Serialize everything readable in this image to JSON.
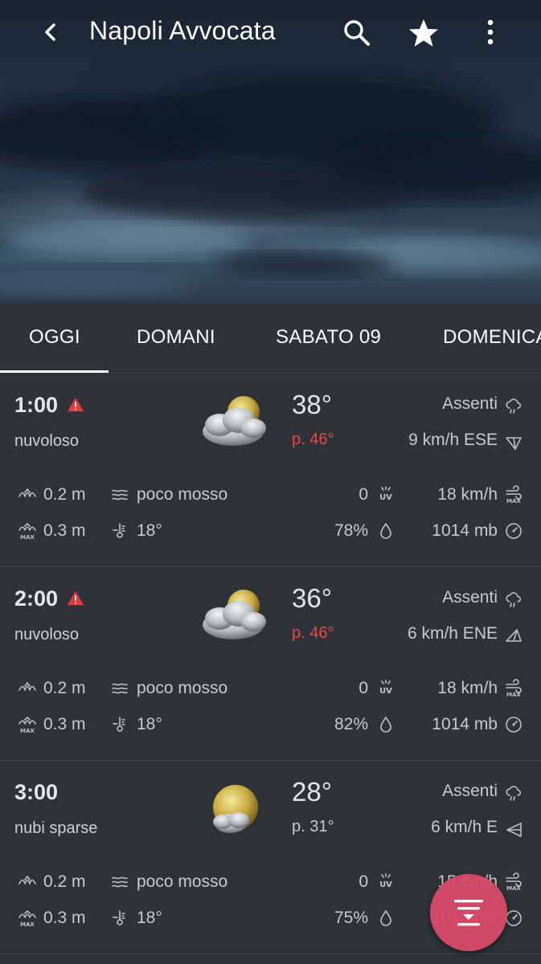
{
  "header": {
    "title": "Napoli Avvocata"
  },
  "tabs": [
    {
      "label": "OGGI",
      "selected": true
    },
    {
      "label": "DOMANI",
      "selected": false
    },
    {
      "label": "SABATO 09",
      "selected": false
    },
    {
      "label": "DOMENICA",
      "selected": false
    }
  ],
  "colors": {
    "alert": "#e5393b",
    "perceived_alert": "#e5484d",
    "perceived_normal": "#c9cacc",
    "fab": "#d64a6a"
  },
  "hours": [
    {
      "time": "1:00",
      "alert": true,
      "condition": "nuvoloso",
      "icon": "cloudy-sun-icon",
      "temp": "38°",
      "perceived": "p. 46°",
      "perceived_alert": true,
      "precipitation": "Assenti",
      "wind": "9 km/h ESE",
      "wind_dir_icon": "wind-direction-ese-icon",
      "wave_height": "0.2 m",
      "sea_state": "poco mosso",
      "uv": "0",
      "gust": "18 km/h",
      "wave_max": "0.3 m",
      "water_temp": "18°",
      "humidity": "78%",
      "pressure": "1014 mb"
    },
    {
      "time": "2:00",
      "alert": true,
      "condition": "nuvoloso",
      "icon": "cloudy-sun-icon",
      "temp": "36°",
      "perceived": "p. 46°",
      "perceived_alert": true,
      "precipitation": "Assenti",
      "wind": "6 km/h ENE",
      "wind_dir_icon": "wind-direction-ene-icon",
      "wave_height": "0.2 m",
      "sea_state": "poco mosso",
      "uv": "0",
      "gust": "18 km/h",
      "wave_max": "0.3 m",
      "water_temp": "18°",
      "humidity": "82%",
      "pressure": "1014 mb"
    },
    {
      "time": "3:00",
      "alert": false,
      "condition": "nubi sparse",
      "icon": "partly-cloudy-icon",
      "temp": "28°",
      "perceived": "p. 31°",
      "perceived_alert": false,
      "precipitation": "Assenti",
      "wind": "6 km/h E",
      "wind_dir_icon": "wind-direction-e-icon",
      "wave_height": "0.2 m",
      "sea_state": "poco mosso",
      "uv": "0",
      "gust": "15 km/h",
      "wave_max": "0.3 m",
      "water_temp": "18°",
      "humidity": "75%",
      "pressure": "1013 mb"
    }
  ]
}
